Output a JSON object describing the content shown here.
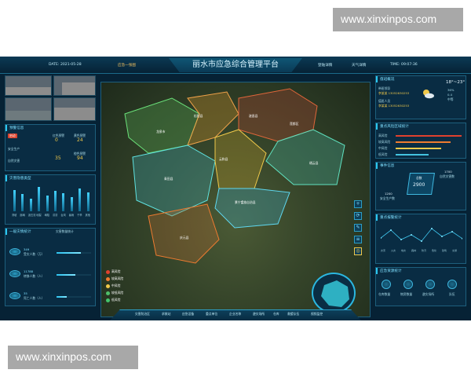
{
  "watermark": {
    "top": "www.xinxinpos.com",
    "bottom": "www.xinxinpos.com"
  },
  "header": {
    "title": "丽水市应急综合管理平台",
    "date": "DATE: 2021-05-28",
    "home": "应急一张图",
    "btn_login": "登陆详情",
    "btn_weather": "天气详情",
    "time": "TIME: 09:07:36"
  },
  "left": {
    "duty_title": "预警信息",
    "pill": "启动",
    "rows": [
      {
        "label": "红色预警",
        "v1": "0",
        "label2": "黄色预警",
        "v2": "24"
      },
      {
        "label": "安全生产",
        "v1": "",
        "label2": "",
        "v2": ""
      },
      {
        "label": "自然灾害",
        "v1": "35",
        "label2": "橙色预警",
        "v2": "94"
      }
    ],
    "chart_title": "灾害隐患类型",
    "bar_values": [
      40,
      32,
      24,
      45,
      30,
      38,
      34,
      26,
      42,
      36
    ],
    "bar_labels": [
      "滑坡",
      "崩塌",
      "泥石流",
      "地裂",
      "塌陷",
      "洪涝",
      "台风",
      "暴雨",
      "干旱",
      "其他"
    ],
    "stats_title": "一般灾情统计",
    "stats_sub": "灾害数量统计",
    "stats": [
      {
        "label": "受灾人数（万）",
        "value": "349"
      },
      {
        "label": "转移人数（人）",
        "value": "11788"
      },
      {
        "label": "死亡人数（人）",
        "value": "35"
      }
    ]
  },
  "map": {
    "regions": [
      "龙泉市",
      "松阳县",
      "遂昌县",
      "云和县",
      "莲都区",
      "缙云县",
      "青田县",
      "景宁畲族自治县",
      "庆元县"
    ],
    "legend_title": "风险等级",
    "legend": [
      {
        "label": "高风险",
        "color": "#e0412e"
      },
      {
        "label": "较高风险",
        "color": "#ee7b30"
      },
      {
        "label": "中风险",
        "color": "#f0c94a"
      },
      {
        "label": "较低风险",
        "color": "#4fbf6a"
      },
      {
        "label": "低风险",
        "color": "#43c46c"
      }
    ]
  },
  "bottom_nav": [
    "灾害防治区",
    "求救站",
    "应急设备",
    "重点单位",
    "企业名称",
    "避灾场所",
    "仓库",
    "救援队伍",
    "视频监控"
  ],
  "right": {
    "duty_title": "值班概况",
    "leader_label": "带班领导",
    "leader_phone": "李某某 13052630253",
    "staff_label": "值班人员",
    "staff_phone": "李某某 13052630253",
    "weather_temp": "18°~23°",
    "weather_items": [
      "36%",
      "0.4",
      "中等"
    ],
    "risk_title": "重点风险区域统计",
    "risk_rows": [
      {
        "label": "高风险",
        "color": "#e0412e",
        "pct": 0.88
      },
      {
        "label": "较高风险",
        "color": "#ee7b30",
        "pct": 0.72
      },
      {
        "label": "中风险",
        "color": "#f0c94a",
        "pct": 0.6
      },
      {
        "label": "低风险",
        "color": "#43c4e0",
        "pct": 0.45
      }
    ],
    "event_title": "事件信息",
    "event_center_label": "总数",
    "event_center_value": "2900",
    "event_nodes": [
      {
        "v": "1700",
        "l": "自然灾害数"
      },
      {
        "v": "1200",
        "l": "安全生产数"
      }
    ],
    "alarm_title": "重点报警统计",
    "line_values": [
      30,
      55,
      25,
      40,
      20,
      60,
      35,
      50,
      28
    ],
    "line_labels": [
      "灾害",
      "火灾",
      "地灾",
      "森林",
      "防汛",
      "危化",
      "建筑",
      "交通",
      "其他"
    ],
    "resource_title": "应急资源统计",
    "resources": [
      "仓库数量",
      "物资数量",
      "避灾场所",
      "队伍"
    ]
  }
}
